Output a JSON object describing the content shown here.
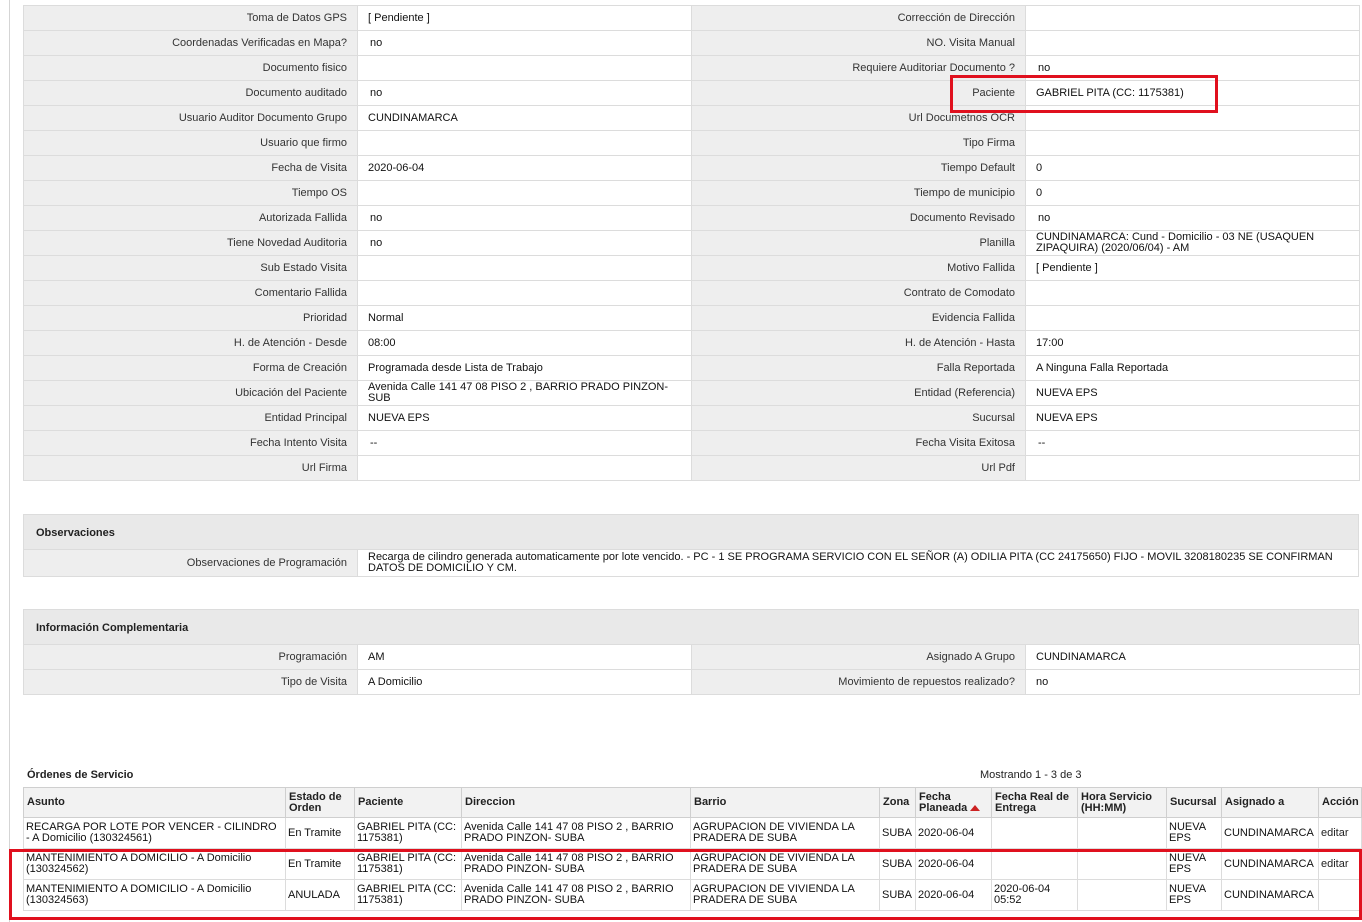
{
  "detail_rows": [
    {
      "l1": "Toma de Datos GPS",
      "v1": "[ Pendiente ]",
      "l2": "Corrección de Dirección",
      "v2": ""
    },
    {
      "l1": "Coordenadas Verificadas en Mapa?",
      "v1": "no",
      "l2": "NO. Visita Manual",
      "v2": ""
    },
    {
      "l1": "Documento fisico",
      "v1": "",
      "l2": "Requiere Auditoriar Documento ?",
      "v2": "no"
    },
    {
      "l1": "Documento auditado",
      "v1": "no",
      "l2": "Paciente",
      "v2": "GABRIEL PITA (CC: 1175381)"
    },
    {
      "l1": "Usuario Auditor Documento Grupo",
      "v1": "CUNDINAMARCA",
      "l2": "Url Documetnos OCR",
      "v2": ""
    },
    {
      "l1": "Usuario que firmo",
      "v1": "",
      "l2": "Tipo Firma",
      "v2": ""
    },
    {
      "l1": "Fecha de Visita",
      "v1": "2020-06-04",
      "l2": "Tiempo Default",
      "v2": "0"
    },
    {
      "l1": "Tiempo OS",
      "v1": "",
      "l2": "Tiempo de municipio",
      "v2": "0"
    },
    {
      "l1": "Autorizada Fallida",
      "v1": "no",
      "l2": "Documento Revisado",
      "v2": "no"
    },
    {
      "l1": "Tiene Novedad Auditoria",
      "v1": "no",
      "l2": "Planilla",
      "v2": "CUNDINAMARCA: Cund - Domicilio - 03 NE (USAQUEN ZIPAQUIRA) (2020/06/04) - AM"
    },
    {
      "l1": "Sub Estado Visita",
      "v1": "",
      "l2": "Motivo Fallida",
      "v2": "[ Pendiente ]"
    },
    {
      "l1": "Comentario Fallida",
      "v1": "",
      "l2": "Contrato de Comodato",
      "v2": ""
    },
    {
      "l1": "Prioridad",
      "v1": "Normal",
      "l2": "Evidencia Fallida",
      "v2": ""
    },
    {
      "l1": "H. de Atención - Desde",
      "v1": "08:00",
      "l2": "H. de Atención - Hasta",
      "v2": "17:00"
    },
    {
      "l1": "Forma de Creación",
      "v1": "Programada desde Lista de Trabajo",
      "l2": "Falla Reportada",
      "v2": "A Ninguna Falla Reportada"
    },
    {
      "l1": "Ubicación del Paciente",
      "v1": "Avenida Calle 141 47 08 PISO 2 , BARRIO PRADO PINZON- SUB",
      "l2": "Entidad (Referencia)",
      "v2": "NUEVA EPS"
    },
    {
      "l1": "Entidad Principal",
      "v1": "NUEVA EPS",
      "l2": "Sucursal",
      "v2": "NUEVA EPS"
    },
    {
      "l1": "Fecha Intento Visita",
      "v1": "--",
      "l2": "Fecha Visita Exitosa",
      "v2": "--"
    },
    {
      "l1": "Url Firma",
      "v1": "",
      "l2": "Url Pdf",
      "v2": ""
    }
  ],
  "observaciones": {
    "title": "Observaciones",
    "label": "Observaciones de Programación",
    "value": "Recarga de cilindro generada automaticamente por lote vencido. - PC - 1 SE PROGRAMA SERVICIO CON EL SEÑOR (A) ODILIA PITA (CC 24175650) FIJO - MOVIL 3208180235 SE CONFIRMAN DATOS DE DOMICILIO Y CM."
  },
  "complementaria": {
    "title": "Información Complementaria",
    "rows": [
      {
        "l1": "Programación",
        "v1": "AM",
        "l2": "Asignado A Grupo",
        "v2": "CUNDINAMARCA"
      },
      {
        "l1": "Tipo de Visita",
        "v1": "A Domicilio",
        "l2": "Movimiento de repuestos realizado?",
        "v2": "no"
      }
    ]
  },
  "ordenes": {
    "title": "Órdenes de Servicio",
    "count": "Mostrando 1 - 3 de 3",
    "headers": [
      "Asunto",
      "Estado de Orden",
      "Paciente",
      "Direccion",
      "Barrio",
      "Zona",
      "Fecha Planeada",
      "Fecha Real de Entrega",
      "Hora Servicio (HH:MM)",
      "Sucursal",
      "Asignado a",
      "Acción"
    ],
    "rows": [
      [
        "RECARGA POR LOTE POR VENCER - CILINDRO - A Domicilio (130324561)",
        "En Tramite",
        "GABRIEL PITA (CC: 1175381)",
        "Avenida Calle 141 47 08 PISO 2 , BARRIO PRADO PINZON- SUBA",
        "AGRUPACION DE VIVIENDA LA PRADERA DE SUBA",
        "SUBA",
        "2020-06-04",
        "",
        "",
        "NUEVA EPS",
        "CUNDINAMARCA",
        "editar"
      ],
      [
        "MANTENIMIENTO A DOMICILIO - A Domicilio (130324562)",
        "En Tramite",
        "GABRIEL PITA (CC: 1175381)",
        "Avenida Calle 141 47 08 PISO 2 , BARRIO PRADO PINZON- SUBA",
        "AGRUPACION DE VIVIENDA LA PRADERA DE SUBA",
        "SUBA",
        "2020-06-04",
        "",
        "",
        "NUEVA EPS",
        "CUNDINAMARCA",
        "editar"
      ],
      [
        "MANTENIMIENTO A DOMICILIO - A Domicilio (130324563)",
        "ANULADA",
        "GABRIEL PITA (CC: 1175381)",
        "Avenida Calle 141 47 08 PISO 2 , BARRIO PRADO PINZON- SUBA",
        "AGRUPACION DE VIVIENDA LA PRADERA DE SUBA",
        "SUBA",
        "2020-06-04",
        "2020-06-04 05:52",
        "",
        "NUEVA EPS",
        "CUNDINAMARCA",
        ""
      ]
    ]
  },
  "colors": {
    "highlight": "#e0101e",
    "label_bg": "#eeeeee",
    "header_bg": "#e9e9e9"
  }
}
